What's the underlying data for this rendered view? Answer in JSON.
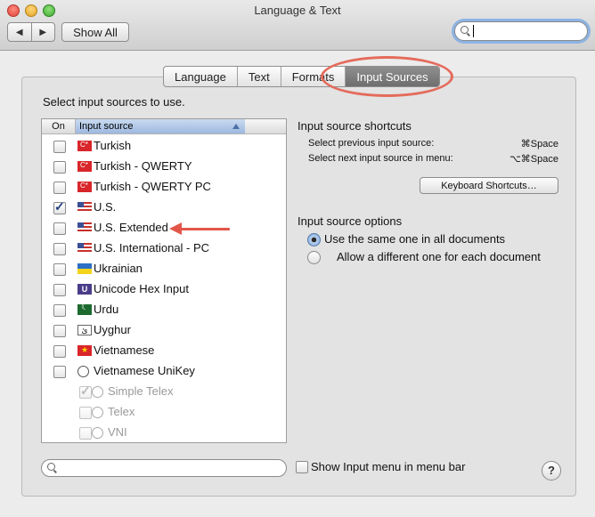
{
  "window": {
    "title": "Language & Text"
  },
  "toolbar": {
    "back_icon": "◀",
    "forward_icon": "▶",
    "show_all": "Show All",
    "search_value": ""
  },
  "tabs": [
    {
      "label": "Language",
      "selected": false
    },
    {
      "label": "Text",
      "selected": false
    },
    {
      "label": "Formats",
      "selected": false
    },
    {
      "label": "Input Sources",
      "selected": true
    }
  ],
  "main": {
    "instruction": "Select input sources to use.",
    "columns": {
      "on": "On",
      "source": "Input source"
    },
    "sources": [
      {
        "label": "Turkish",
        "checked": false,
        "icon": "turkey-flag-icon"
      },
      {
        "label": "Turkish - QWERTY",
        "checked": false,
        "icon": "turkey-flag-icon"
      },
      {
        "label": "Turkish - QWERTY PC",
        "checked": false,
        "icon": "turkey-flag-icon"
      },
      {
        "label": "U.S.",
        "checked": true,
        "icon": "us-flag-icon"
      },
      {
        "label": "U.S. Extended",
        "checked": false,
        "icon": "us-flag-icon"
      },
      {
        "label": "U.S. International - PC",
        "checked": false,
        "icon": "us-flag-icon"
      },
      {
        "label": "Ukrainian",
        "checked": false,
        "icon": "ukraine-flag-icon"
      },
      {
        "label": "Unicode Hex Input",
        "checked": false,
        "icon": "unicode-icon"
      },
      {
        "label": "Urdu",
        "checked": false,
        "icon": "pakistan-flag-icon"
      },
      {
        "label": "Uyghur",
        "checked": false,
        "icon": "uyghur-icon"
      },
      {
        "label": "Vietnamese",
        "checked": false,
        "icon": "vietnam-flag-icon"
      },
      {
        "label": "Vietnamese UniKey",
        "checked": false,
        "icon": "unikey-icon"
      }
    ],
    "sub_sources": [
      {
        "label": "Simple Telex",
        "checked": true,
        "icon": "unikey-icon"
      },
      {
        "label": "Telex",
        "checked": false,
        "icon": "unikey-icon"
      },
      {
        "label": "VNI",
        "checked": false,
        "icon": "unikey-icon"
      }
    ],
    "shortcuts": {
      "title": "Input source shortcuts",
      "prev_label": "Select previous input source:",
      "prev_key": "⌘Space",
      "next_label": "Select next input source in menu:",
      "next_key": "⌥⌘Space",
      "button": "Keyboard Shortcuts…"
    },
    "options": {
      "title": "Input source options",
      "choices": [
        {
          "label": "Use the same one in all documents",
          "selected": true
        },
        {
          "label": "Allow a different one for each document",
          "selected": false
        }
      ]
    },
    "bottom": {
      "search_value": "",
      "show_menu_label": "Show Input menu in menu bar",
      "show_menu_checked": false,
      "help": "?"
    }
  },
  "colors": {
    "annotation": "#e2564a",
    "selected_tab": "#7a7a7a",
    "header_highlight": "#a9c2e6"
  }
}
